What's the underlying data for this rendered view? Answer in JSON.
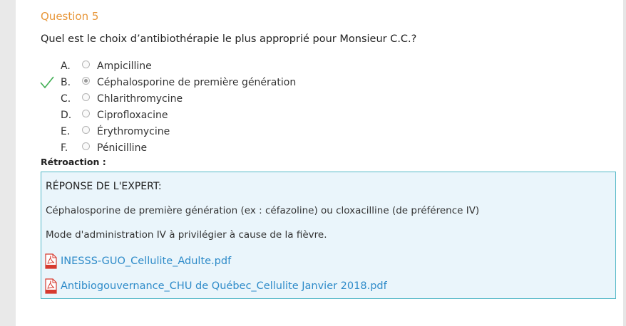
{
  "question": {
    "number_label": "Question 5",
    "text": "Quel est le choix d’antibiothérapie le plus approprié pour Monsieur C.C.?"
  },
  "options": [
    {
      "letter": "A.",
      "label": "Ampicilline",
      "selected": false,
      "correct": false
    },
    {
      "letter": "B.",
      "label": "Céphalosporine de première génération",
      "selected": true,
      "correct": true
    },
    {
      "letter": "C.",
      "label": "Chlarithromycine",
      "selected": false,
      "correct": false
    },
    {
      "letter": "D.",
      "label": "Ciprofloxacine",
      "selected": false,
      "correct": false
    },
    {
      "letter": "E.",
      "label": "Érythromycine",
      "selected": false,
      "correct": false
    },
    {
      "letter": "F.",
      "label": "Pénicilline",
      "selected": false,
      "correct": false
    }
  ],
  "feedback": {
    "title": "Rétroaction :",
    "heading": "RÉPONSE DE L'EXPERT:",
    "line1": "Céphalosporine de première génération (ex : céfazoline) ou cloxacilline (de préférence IV)",
    "line2": "Mode d'administration IV à privilégier à cause de la fièvre.",
    "attachments": [
      {
        "name": "INESSS-GUO_Cellulite_Adulte.pdf",
        "icon": "pdf-icon"
      },
      {
        "name": "Antibiogouvernance_CHU de Québec_Cellulite Janvier 2018.pdf",
        "icon": "pdf-icon"
      }
    ]
  },
  "colors": {
    "question_number": "#e8973a",
    "check_mark": "#3fae52",
    "feedback_border": "#54b8c7",
    "feedback_bg": "#eaf5fb",
    "link": "#2e8bc9",
    "pdf_icon": "#d63a2f"
  }
}
